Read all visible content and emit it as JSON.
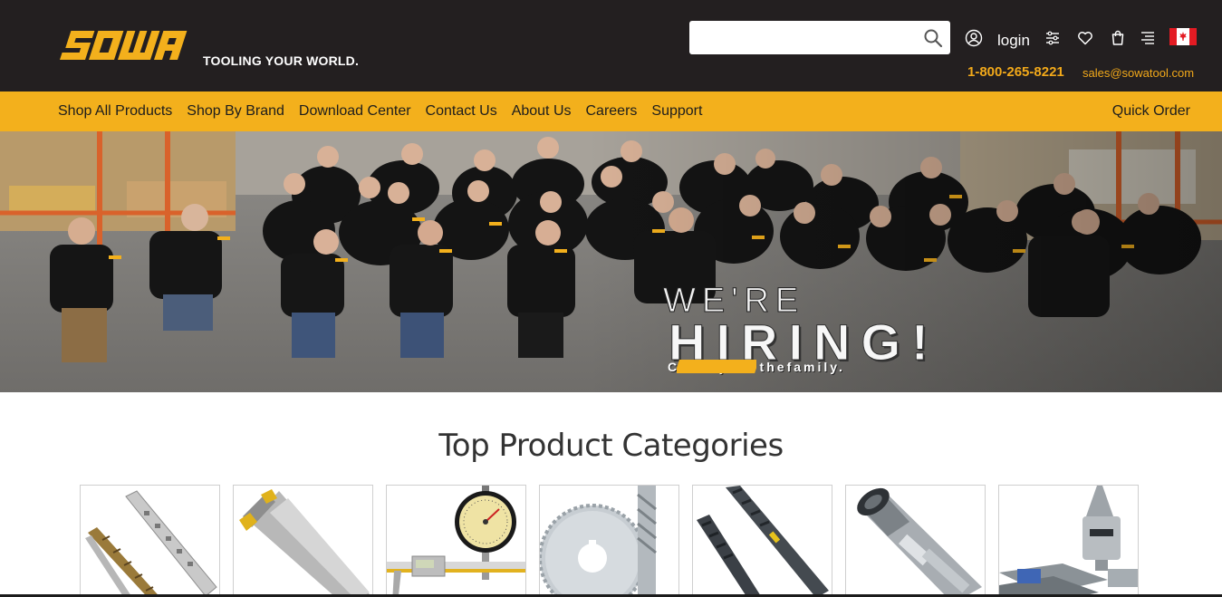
{
  "header": {
    "brand": "SOWA",
    "tagline": "TOOLING YOUR WORLD.",
    "search": {
      "placeholder": "",
      "value": ""
    },
    "login_label": "login",
    "phone": "1-800-265-8221",
    "email": "sales@sowatool.com",
    "icons": [
      "user-icon",
      "filter-icon",
      "heart-icon",
      "cart-icon",
      "menu-icon",
      "canada-flag-icon"
    ]
  },
  "nav": {
    "items": [
      "Shop All Products",
      "Shop By Brand",
      "Download Center",
      "Contact Us",
      "About Us",
      "Careers",
      "Support"
    ],
    "quick_order": "Quick Order"
  },
  "hero": {
    "line1": "WE'RE",
    "line2": "HIRING!",
    "line3_before": "Come join the",
    "line3_brand": "SOWA",
    "line3_after": "family."
  },
  "categories": {
    "title": "Top Product Categories",
    "items": [
      "drill-bits",
      "indexable-end-mill",
      "dial-indicator-caliper",
      "saw-blade-end-mill",
      "taps",
      "tool-holder",
      "live-center-vise"
    ]
  },
  "colors": {
    "header_bg": "#231f20",
    "accent": "#f3b01c",
    "contact": "#f2a91a"
  }
}
